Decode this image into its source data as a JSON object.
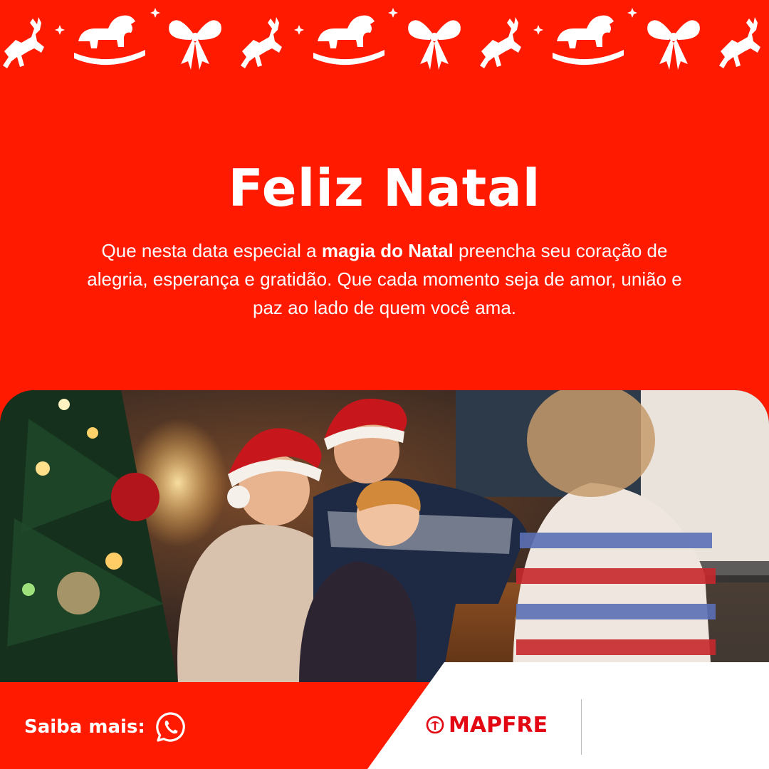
{
  "greeting": {
    "title": "Feliz Natal",
    "message_part1": "Que nesta data especial a ",
    "message_bold": "magia do Natal",
    "message_part2": " preencha seu coração de alegria, esperança e gratidão. Que cada momento seja de amor, união e paz ao lado de quem você ama."
  },
  "footer": {
    "cta_label": "Saiba mais:",
    "cta_icon": "whatsapp-icon",
    "brand_name": "MAPFRE",
    "brand_icon": "mapfre-logo-icon"
  },
  "decorations": {
    "pattern": [
      "reindeer-icon",
      "sparkle-icon",
      "rocking-horse-icon",
      "sparkle-icon",
      "bow-icon"
    ]
  },
  "colors": {
    "background": "#ff1a00",
    "text": "#ffffff",
    "brand_red": "#e30613",
    "footer_panel": "#ffffff"
  }
}
